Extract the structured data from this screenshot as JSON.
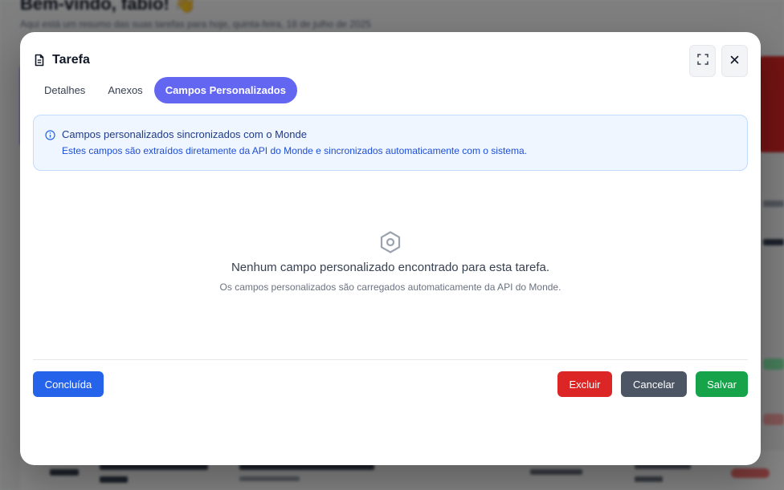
{
  "background": {
    "title": "Bem-vindo, fabio! 👋",
    "subtitle": "Aqui está um resumo das suas tarefas para hoje, quinta-feira, 18 de julho de 2025"
  },
  "modal": {
    "title": "Tarefa",
    "tabs": [
      {
        "label": "Detalhes",
        "active": false
      },
      {
        "label": "Anexos",
        "active": false
      },
      {
        "label": "Campos Personalizados",
        "active": true
      }
    ],
    "info": {
      "title": "Campos personalizados sincronizados com o Monde",
      "description": "Estes campos são extraídos diretamente da API do Monde e sincronizados automaticamente com o sistema."
    },
    "empty_state": {
      "title": "Nenhum campo personalizado encontrado para esta tarefa.",
      "subtitle": "Os campos personalizados são carregados automaticamente da API do Monde."
    },
    "footer": {
      "done_label": "Concluída",
      "delete_label": "Excluir",
      "cancel_label": "Cancelar",
      "save_label": "Salvar"
    }
  },
  "icons": {
    "title": "document-icon",
    "expand": "expand-icon",
    "close": "close-icon",
    "info": "info-icon",
    "empty": "hexagon-settings-icon"
  },
  "colors": {
    "accent": "#6366f1",
    "done": "#2563eb",
    "delete": "#dc2626",
    "cancel": "#4b5563",
    "save": "#16a34a"
  }
}
